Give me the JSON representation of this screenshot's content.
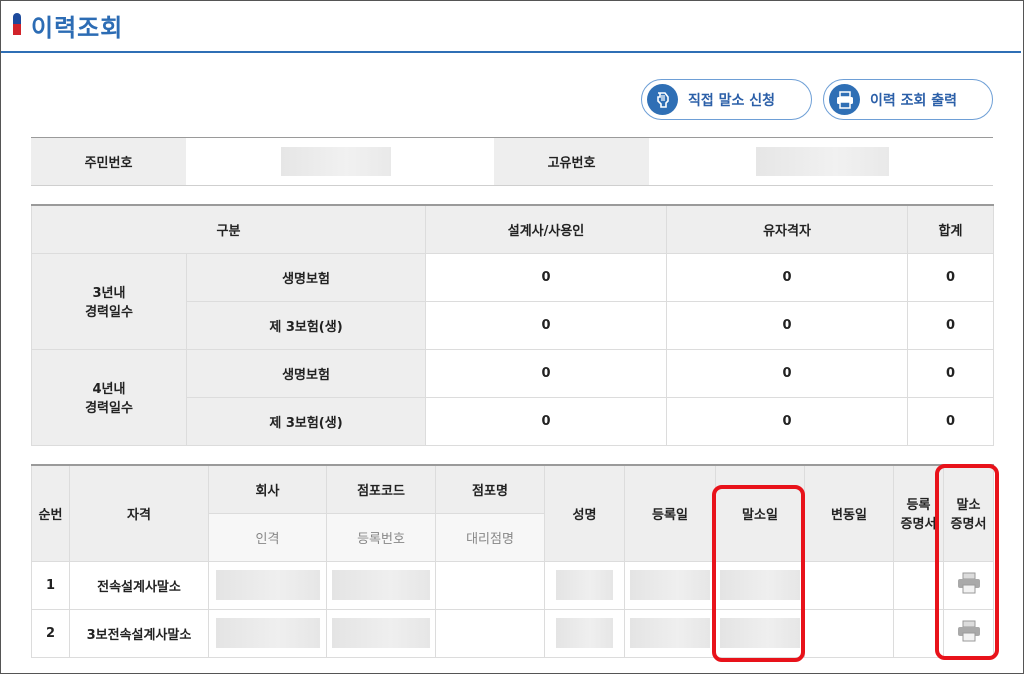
{
  "page": {
    "title": "이력조회"
  },
  "actions": {
    "direct_cancel_label": "직접 말소 신청",
    "print_history_label": "이력 조회 출력"
  },
  "id_info": {
    "resident_no_label": "주민번호",
    "unique_no_label": "고유번호"
  },
  "summary": {
    "headers": [
      "구분",
      "설계사/사용인",
      "유자격자",
      "합계"
    ],
    "groups": [
      {
        "label_line1": "3년내",
        "label_line2": "경력일수",
        "rows": [
          {
            "type": "생명보험",
            "planner": "0",
            "qualified": "0",
            "total": "0"
          },
          {
            "type": "제 3보험(생)",
            "planner": "0",
            "qualified": "0",
            "total": "0"
          }
        ]
      },
      {
        "label_line1": "4년내",
        "label_line2": "경력일수",
        "rows": [
          {
            "type": "생명보험",
            "planner": "0",
            "qualified": "0",
            "total": "0"
          },
          {
            "type": "제 3보험(생)",
            "planner": "0",
            "qualified": "0",
            "total": "0"
          }
        ]
      }
    ]
  },
  "records": {
    "headers": {
      "no": "순번",
      "qualification": "자격",
      "company": "회사",
      "company_sub": "인격",
      "branch_code": "점포코드",
      "branch_code_sub": "등록번호",
      "branch_name": "점포명",
      "branch_name_sub": "대리점명",
      "name": "성명",
      "reg_date": "등록일",
      "cancel_date": "말소일",
      "change_date": "변동일",
      "reg_cert_line1": "등록",
      "reg_cert_line2": "증명서",
      "cancel_cert_line1": "말소",
      "cancel_cert_line2": "증명서"
    },
    "rows": [
      {
        "no": "1",
        "qualification": "전속설계사말소"
      },
      {
        "no": "2",
        "qualification": "3보전속설계사말소"
      }
    ]
  },
  "icons": {
    "direct_cancel": "hand-pointer-icon",
    "print": "printer-icon"
  },
  "colors": {
    "accent": "#2f6fb5",
    "highlight": "#e8121a"
  }
}
